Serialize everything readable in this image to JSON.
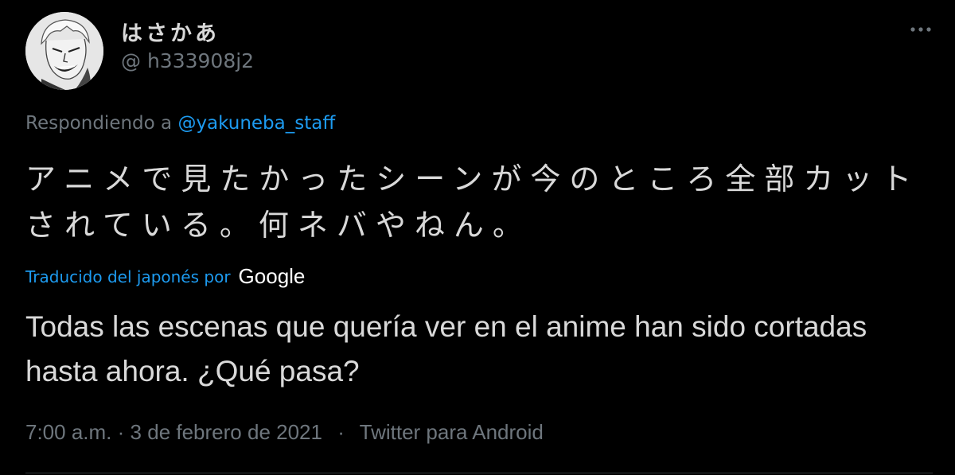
{
  "tweet": {
    "author": {
      "display_name": "はさかあ",
      "handle": "@ h333908j2",
      "avatar_icon": "avatar-manga-face"
    },
    "more_icon": "more-dots-icon",
    "replying": {
      "prefix": "Respondiendo a",
      "mention": "@yakuneba_staff"
    },
    "original_text": "アニメで見たかったシーンが今のところ全部カットされている。何ネバやねん。",
    "translation_attribution": {
      "label": "Traducido del japonés por",
      "provider": "Google"
    },
    "translated_text": "Todas las escenas que quería ver en el anime han sido cortadas hasta ahora. ¿Qué pasa?",
    "meta": {
      "time": "7:00 a.m.",
      "date": "3 de febrero de 2021",
      "dot_separator": "·",
      "source": "Twitter para Android"
    },
    "colors": {
      "background": "#000000",
      "text": "#d9d9d9",
      "muted": "#6e767d",
      "link": "#1d9bf0"
    }
  }
}
